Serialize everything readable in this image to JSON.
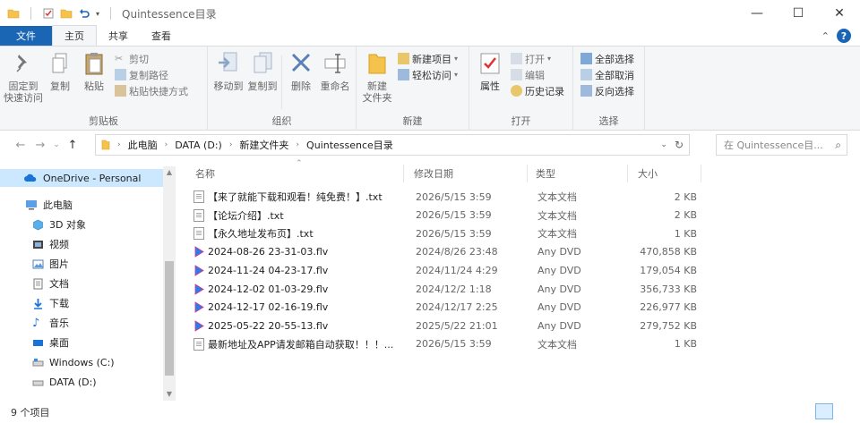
{
  "titlebar": {
    "title": "Quintessence目录",
    "qa_icons": [
      "folder-icon",
      "properties-icon",
      "new-folder-icon",
      "undo-icon"
    ],
    "controls": [
      "minimize",
      "maximize",
      "close"
    ]
  },
  "tabs": [
    {
      "label": "文件",
      "kind": "file"
    },
    {
      "label": "主页",
      "kind": "active"
    },
    {
      "label": "共享",
      "kind": "normal"
    },
    {
      "label": "查看",
      "kind": "normal"
    }
  ],
  "ribbon": {
    "clipboard": {
      "pin": "固定到\n快速访问",
      "copy": "复制",
      "paste": "粘贴",
      "cut": "剪切",
      "copy_path": "复制路径",
      "paste_shortcut": "粘贴快捷方式",
      "label": "剪贴板"
    },
    "organize": {
      "move_to": "移动到",
      "copy_to": "复制到",
      "delete": "删除",
      "rename": "重命名",
      "label": "组织"
    },
    "new": {
      "new_folder": "新建\n文件夹",
      "new_item": "新建项目",
      "easy_access": "轻松访问",
      "label": "新建"
    },
    "open": {
      "properties": "属性",
      "open": "打开",
      "edit": "编辑",
      "history": "历史记录",
      "label": "打开"
    },
    "select": {
      "select_all": "全部选择",
      "select_none": "全部取消",
      "invert": "反向选择",
      "label": "选择"
    }
  },
  "address": {
    "crumbs": [
      "此电脑",
      "DATA (D:)",
      "新建文件夹",
      "Quintessence目录"
    ],
    "search_placeholder": "在 Quintessence目..."
  },
  "sidebar": {
    "items": [
      {
        "label": "OneDrive - Personal",
        "icon": "cloud-icon",
        "selected": true
      },
      {
        "label": "此电脑",
        "icon": "computer-icon",
        "selected": false
      },
      {
        "label": "3D 对象",
        "icon": "cube-icon",
        "selected": false
      },
      {
        "label": "视频",
        "icon": "video-icon",
        "selected": false
      },
      {
        "label": "图片",
        "icon": "image-icon",
        "selected": false
      },
      {
        "label": "文档",
        "icon": "document-icon",
        "selected": false
      },
      {
        "label": "下载",
        "icon": "download-icon",
        "selected": false
      },
      {
        "label": "音乐",
        "icon": "music-icon",
        "selected": false
      },
      {
        "label": "桌面",
        "icon": "desktop-icon",
        "selected": false
      },
      {
        "label": "Windows (C:)",
        "icon": "drive-icon",
        "selected": false
      },
      {
        "label": "DATA (D:)",
        "icon": "drive-icon",
        "selected": false
      }
    ]
  },
  "columns": {
    "name": "名称",
    "date": "修改日期",
    "type": "类型",
    "size": "大小"
  },
  "files": [
    {
      "name": "【来了就能下载和观看！纯免费！】.txt",
      "date": "2026/5/15 3:59",
      "type": "文本文档",
      "size": "2 KB",
      "icon": "text-file-icon"
    },
    {
      "name": "【论坛介绍】.txt",
      "date": "2026/5/15 3:59",
      "type": "文本文档",
      "size": "2 KB",
      "icon": "text-file-icon"
    },
    {
      "name": "【永久地址发布页】.txt",
      "date": "2026/5/15 3:59",
      "type": "文本文档",
      "size": "1 KB",
      "icon": "text-file-icon"
    },
    {
      "name": "2024-08-26 23-31-03.flv",
      "date": "2024/8/26 23:48",
      "type": "Any DVD",
      "size": "470,858 KB",
      "icon": "video-file-icon"
    },
    {
      "name": "2024-11-24 04-23-17.flv",
      "date": "2024/11/24 4:29",
      "type": "Any DVD",
      "size": "179,054 KB",
      "icon": "video-file-icon"
    },
    {
      "name": "2024-12-02 01-03-29.flv",
      "date": "2024/12/2 1:18",
      "type": "Any DVD",
      "size": "356,733 KB",
      "icon": "video-file-icon"
    },
    {
      "name": "2024-12-17 02-16-19.flv",
      "date": "2024/12/17 2:25",
      "type": "Any DVD",
      "size": "226,977 KB",
      "icon": "video-file-icon"
    },
    {
      "name": "2025-05-22 20-55-13.flv",
      "date": "2025/5/22 21:01",
      "type": "Any DVD",
      "size": "279,752 KB",
      "icon": "video-file-icon"
    },
    {
      "name": "最新地址及APP请发邮箱自动获取！！！...",
      "date": "2026/5/15 3:59",
      "type": "文本文档",
      "size": "1 KB",
      "icon": "text-file-icon"
    }
  ],
  "status": {
    "count": "9 个项目"
  },
  "colors": {
    "accent": "#1a66b4",
    "selected": "#cce8ff",
    "ribbon_bg": "#f5f6f7"
  }
}
